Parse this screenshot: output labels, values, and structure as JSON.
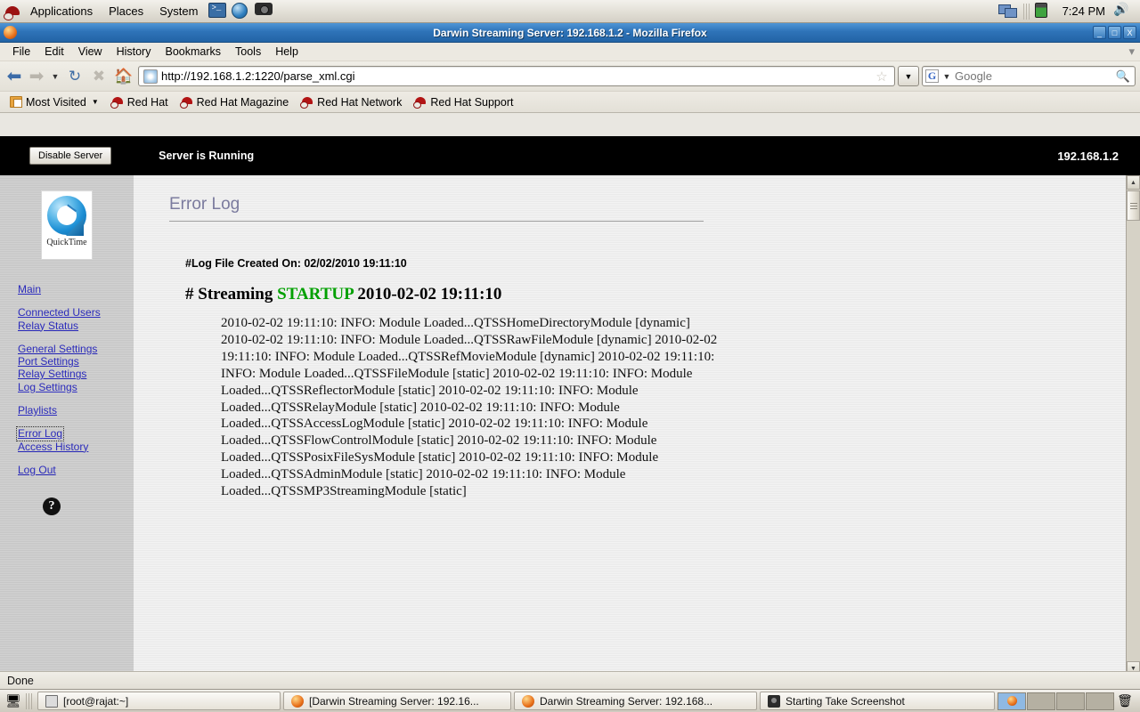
{
  "desktop": {
    "panel": {
      "menus": [
        "Applications",
        "Places",
        "System"
      ],
      "launchers": [
        {
          "name": "terminal-launcher",
          "title": "Terminal"
        },
        {
          "name": "browser-launcher",
          "title": "Web Browser"
        },
        {
          "name": "screenshot-launcher",
          "title": "Take Screenshot"
        }
      ],
      "clock": "7:24 PM"
    },
    "taskbar": {
      "items": [
        {
          "label": "[root@rajat:~]",
          "icon": "terminal-icon",
          "active": false
        },
        {
          "label": "[Darwin Streaming Server: 192.16...",
          "icon": "firefox-icon",
          "active": false
        },
        {
          "label": "Darwin Streaming Server: 192.168...",
          "icon": "firefox-icon",
          "active": true
        },
        {
          "label": "Starting Take Screenshot",
          "icon": "camera-icon",
          "active": false
        }
      ]
    }
  },
  "browser": {
    "window_title": "Darwin Streaming Server: 192.168.1.2 - Mozilla Firefox",
    "window_buttons": {
      "minimize": "_",
      "maximize": "□",
      "close": "X"
    },
    "menubar": [
      "File",
      "Edit",
      "View",
      "History",
      "Bookmarks",
      "Tools",
      "Help"
    ],
    "url": "http://192.168.1.2:1220/parse_xml.cgi",
    "search": {
      "engine": "G",
      "placeholder": "Google",
      "value": ""
    },
    "bookmarks": [
      {
        "label": "Most Visited",
        "icon": "most-visited-icon",
        "has_caret": true
      },
      {
        "label": "Red Hat",
        "icon": "redhat-icon",
        "has_caret": false
      },
      {
        "label": "Red Hat Magazine",
        "icon": "redhat-icon",
        "has_caret": false
      },
      {
        "label": "Red Hat Network",
        "icon": "redhat-icon",
        "has_caret": false
      },
      {
        "label": "Red Hat Support",
        "icon": "redhat-icon",
        "has_caret": false
      }
    ],
    "status": "Done"
  },
  "dss": {
    "header": {
      "disable_button": "Disable Server",
      "status": "Server is Running",
      "ip": "192.168.1.2"
    },
    "sidebar": {
      "logo_caption": "QuickTime",
      "groups": [
        [
          {
            "label": "Main",
            "focused": false
          }
        ],
        [
          {
            "label": "Connected Users",
            "focused": false
          },
          {
            "label": "Relay Status",
            "focused": false
          }
        ],
        [
          {
            "label": "General Settings",
            "focused": false
          },
          {
            "label": "Port Settings",
            "focused": false
          },
          {
            "label": "Relay Settings",
            "focused": false
          },
          {
            "label": "Log Settings",
            "focused": false
          }
        ],
        [
          {
            "label": "Playlists",
            "focused": false
          }
        ],
        [
          {
            "label": "Error Log",
            "focused": true
          },
          {
            "label": "Access History",
            "focused": false
          }
        ],
        [
          {
            "label": "Log Out",
            "focused": false
          }
        ]
      ],
      "help_glyph": "?"
    },
    "content": {
      "title": "Error Log",
      "log_created": "#Log File Created On: 02/02/2010 19:11:10",
      "startup": {
        "prefix": "# Streaming ",
        "keyword": "STARTUP",
        "suffix": " 2010-02-02 19:11:10"
      },
      "log_text": "2010-02-02 19:11:10: INFO: Module Loaded...QTSSHomeDirectoryModule [dynamic] 2010-02-02 19:11:10: INFO: Module Loaded...QTSSRawFileModule [dynamic] 2010-02-02 19:11:10: INFO: Module Loaded...QTSSRefMovieModule [dynamic] 2010-02-02 19:11:10: INFO: Module Loaded...QTSSFileModule [static] 2010-02-02 19:11:10: INFO: Module Loaded...QTSSReflectorModule [static] 2010-02-02 19:11:10: INFO: Module Loaded...QTSSRelayModule [static] 2010-02-02 19:11:10: INFO: Module Loaded...QTSSAccessLogModule [static] 2010-02-02 19:11:10: INFO: Module Loaded...QTSSFlowControlModule [static] 2010-02-02 19:11:10: INFO: Module Loaded...QTSSPosixFileSysModule [static] 2010-02-02 19:11:10: INFO: Module Loaded...QTSSAdminModule [static] 2010-02-02 19:11:10: INFO: Module Loaded...QTSSMP3StreamingModule [static]"
    }
  }
}
